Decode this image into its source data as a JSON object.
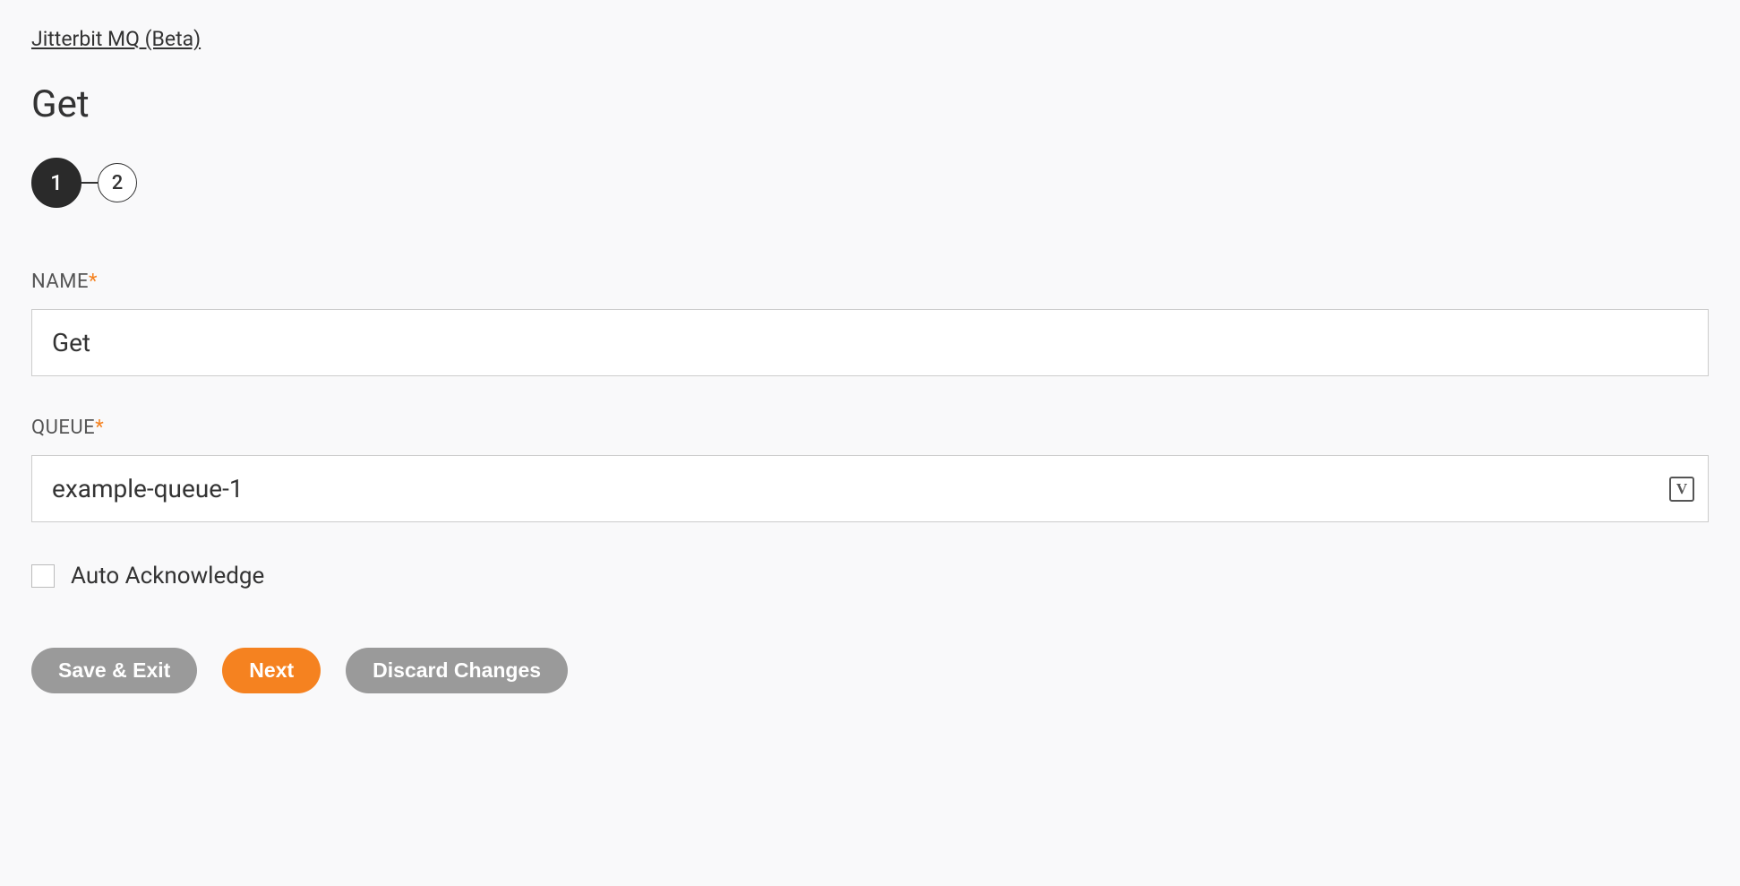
{
  "breadcrumb": {
    "label": "Jitterbit MQ (Beta)"
  },
  "page": {
    "title": "Get"
  },
  "stepper": {
    "step1": "1",
    "step2": "2"
  },
  "form": {
    "name": {
      "label": "NAME",
      "required": "*",
      "value": "Get"
    },
    "queue": {
      "label": "QUEUE",
      "required": "*",
      "value": "example-queue-1"
    },
    "autoAck": {
      "label": "Auto Acknowledge",
      "checked": false
    }
  },
  "buttons": {
    "saveExit": "Save & Exit",
    "next": "Next",
    "discard": "Discard Changes"
  },
  "icons": {
    "variable": "V"
  }
}
